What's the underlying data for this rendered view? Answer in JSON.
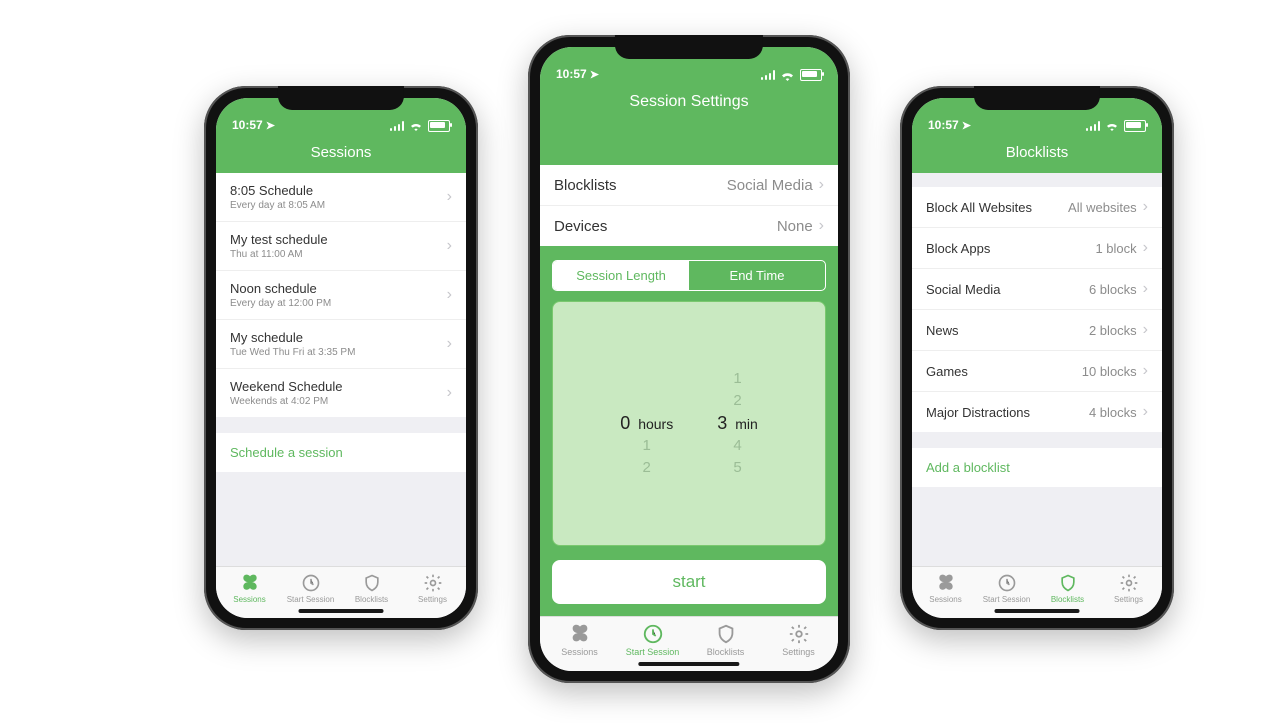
{
  "status": {
    "time": "10:57"
  },
  "sessions_screen": {
    "title": "Sessions",
    "items": [
      {
        "title": "8:05 Schedule",
        "sub": "Every day at 8:05 AM"
      },
      {
        "title": "My test schedule",
        "sub": "Thu at 11:00 AM"
      },
      {
        "title": "Noon schedule",
        "sub": "Every day at 12:00 PM"
      },
      {
        "title": "My schedule",
        "sub": "Tue Wed Thu Fri at 3:35 PM"
      },
      {
        "title": "Weekend Schedule",
        "sub": "Weekends at 4:02 PM"
      }
    ],
    "cta": "Schedule a session"
  },
  "settings_screen": {
    "title": "Session Settings",
    "rows": {
      "blocklists_label": "Blocklists",
      "blocklists_value": "Social Media",
      "devices_label": "Devices",
      "devices_value": "None"
    },
    "segmented": {
      "length": "Session Length",
      "end": "End Time"
    },
    "picker": {
      "hours_value": "0",
      "hours_unit": "hours",
      "min_value": "3",
      "min_unit": "min",
      "hours_around": [
        "",
        "",
        "0",
        "1",
        "2"
      ],
      "min_around": [
        "1",
        "2",
        "3",
        "4",
        "5"
      ]
    },
    "start": "start"
  },
  "blocklists_screen": {
    "title": "Blocklists",
    "items": [
      {
        "title": "Block All Websites",
        "value": "All websites"
      },
      {
        "title": "Block Apps",
        "value": "1 block"
      },
      {
        "title": "Social Media",
        "value": "6 blocks"
      },
      {
        "title": "News",
        "value": "2 blocks"
      },
      {
        "title": "Games",
        "value": "10 blocks"
      },
      {
        "title": "Major Distractions",
        "value": "4 blocks"
      }
    ],
    "cta": "Add a blocklist"
  },
  "tabs": {
    "sessions": "Sessions",
    "start": "Start Session",
    "block": "Blocklists",
    "settings": "Settings"
  }
}
